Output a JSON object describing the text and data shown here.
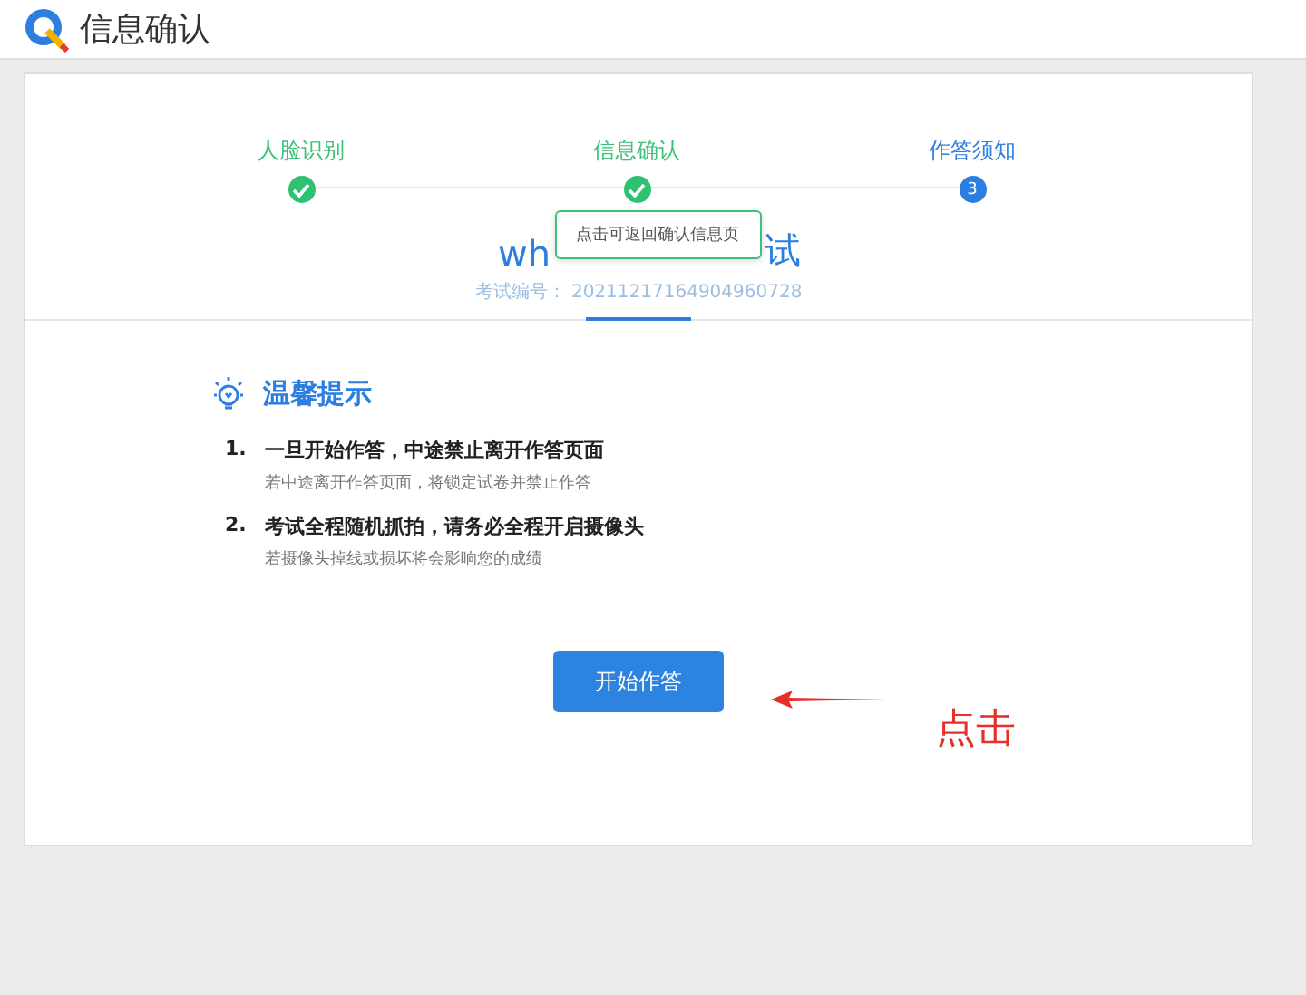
{
  "header": {
    "title": "信息确认"
  },
  "steps": [
    {
      "label": "人脸识别",
      "done": true
    },
    {
      "label": "信息确认",
      "done": true
    },
    {
      "label": "作答须知",
      "done": false,
      "marker": "3"
    }
  ],
  "tooltip": "点击可返回确认信息页",
  "exam": {
    "title_start": "wh",
    "title_end": "试",
    "number_label": "考试编号：",
    "number": "20211217164904960728"
  },
  "tips": {
    "heading": "温馨提示",
    "items": [
      {
        "index": "1.",
        "title": "一旦开始作答，中途禁止离开作答页面",
        "detail": "若中途离开作答页面，将锁定试卷并禁止作答"
      },
      {
        "index": "2.",
        "title": "考试全程随机抓拍，请务必全程开启摄像头",
        "detail": "若摄像头掉线或损坏将会影响您的成绩"
      }
    ]
  },
  "start_button": "开始作答",
  "annotation": "点击"
}
